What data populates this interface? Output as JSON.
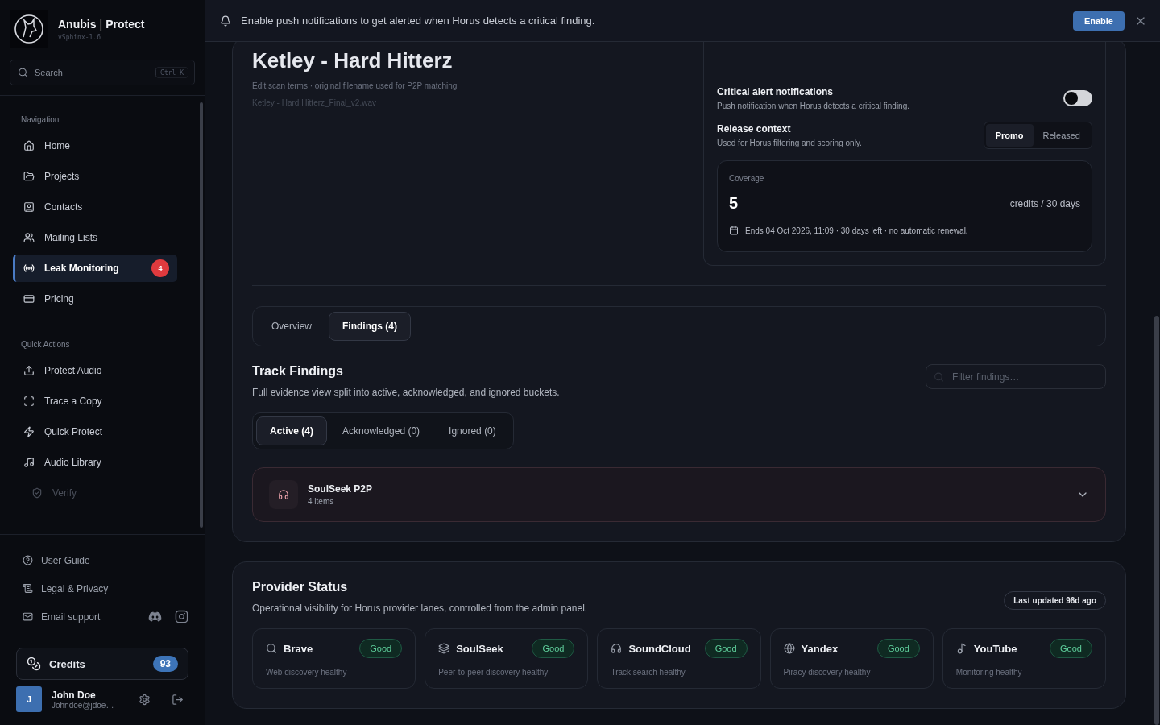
{
  "brand": {
    "name": "Anubis",
    "separator": "|",
    "product": "Protect",
    "version": "vSphinx-1.6"
  },
  "search": {
    "placeholder": "Search",
    "shortcut": "Ctrl K"
  },
  "nav_sections": [
    {
      "title": "Navigation",
      "items": [
        {
          "label": "Home",
          "selected": false
        },
        {
          "label": "Projects",
          "selected": false
        },
        {
          "label": "Contacts",
          "selected": false
        },
        {
          "label": "Mailing Lists",
          "selected": false
        },
        {
          "label": "Leak Monitoring",
          "selected": true,
          "badge": "4"
        },
        {
          "label": "Pricing",
          "selected": false
        }
      ]
    },
    {
      "title": "Quick Actions",
      "items": [
        {
          "label": "Protect Audio",
          "selected": false,
          "disabled": false
        },
        {
          "label": "Trace a Copy",
          "selected": false,
          "disabled": false
        },
        {
          "label": "Quick Protect",
          "selected": false,
          "disabled": false
        },
        {
          "label": "Audio Library",
          "selected": false,
          "disabled": false
        },
        {
          "label": "Verify",
          "selected": false,
          "disabled": true
        }
      ]
    }
  ],
  "footer_links": [
    {
      "label": "User Guide"
    },
    {
      "label": "Legal & Privacy"
    },
    {
      "label": "Email support"
    }
  ],
  "credits": {
    "label": "Credits",
    "count": "93"
  },
  "user": {
    "initial": "J",
    "name": "John Doe",
    "email": "Johndoe@jdoe…"
  },
  "banner": {
    "message": "Enable push notifications to get alerted when Horus detects a critical finding.",
    "button": "Enable"
  },
  "track": {
    "title": "Ketley - Hard Hitterz",
    "subtitle": "Edit scan terms · original filename used for P2P matching",
    "filename": "Ketley - Hard Hitterz_Final_v2.wav"
  },
  "alerts": {
    "title": "Critical alert notifications",
    "description": "Push notification when Horus detects a critical finding.",
    "on": false
  },
  "release_context": {
    "title": "Release context",
    "description": "Used for Horus filtering and scoring only.",
    "options": [
      {
        "label": "Promo",
        "selected": true
      },
      {
        "label": "Released",
        "selected": false
      }
    ]
  },
  "coverage": {
    "label": "Coverage",
    "value": "5",
    "unit": "credits / 30 days",
    "note": "Ends 04 Oct 2026, 11:09 · 30 days left · no automatic renewal."
  },
  "tabs": [
    {
      "label": "Overview",
      "selected": false
    },
    {
      "label": "Findings (4)",
      "selected": true
    }
  ],
  "findings": {
    "title": "Track Findings",
    "description": "Full evidence view split into active, acknowledged, and ignored buckets.",
    "filter_placeholder": "Filter findings…",
    "buckets": [
      {
        "label": "Active (4)",
        "selected": true
      },
      {
        "label": "Acknowledged (0)",
        "selected": false
      },
      {
        "label": "Ignored (0)",
        "selected": false
      }
    ],
    "groups": [
      {
        "name": "SoulSeek P2P",
        "count": "4 items",
        "expanded": false
      }
    ]
  },
  "providers": {
    "title": "Provider Status",
    "description": "Operational visibility for Horus provider lanes, controlled from the admin panel.",
    "updated": "Last updated 96d ago",
    "items": [
      {
        "name": "Brave",
        "status": "Good",
        "note": "Web discovery healthy"
      },
      {
        "name": "SoulSeek",
        "status": "Good",
        "note": "Peer-to-peer discovery healthy"
      },
      {
        "name": "SoundCloud",
        "status": "Good",
        "note": "Track search healthy"
      },
      {
        "name": "Yandex",
        "status": "Good",
        "note": "Piracy discovery healthy"
      },
      {
        "name": "YouTube",
        "status": "Good",
        "note": "Monitoring healthy"
      }
    ]
  }
}
